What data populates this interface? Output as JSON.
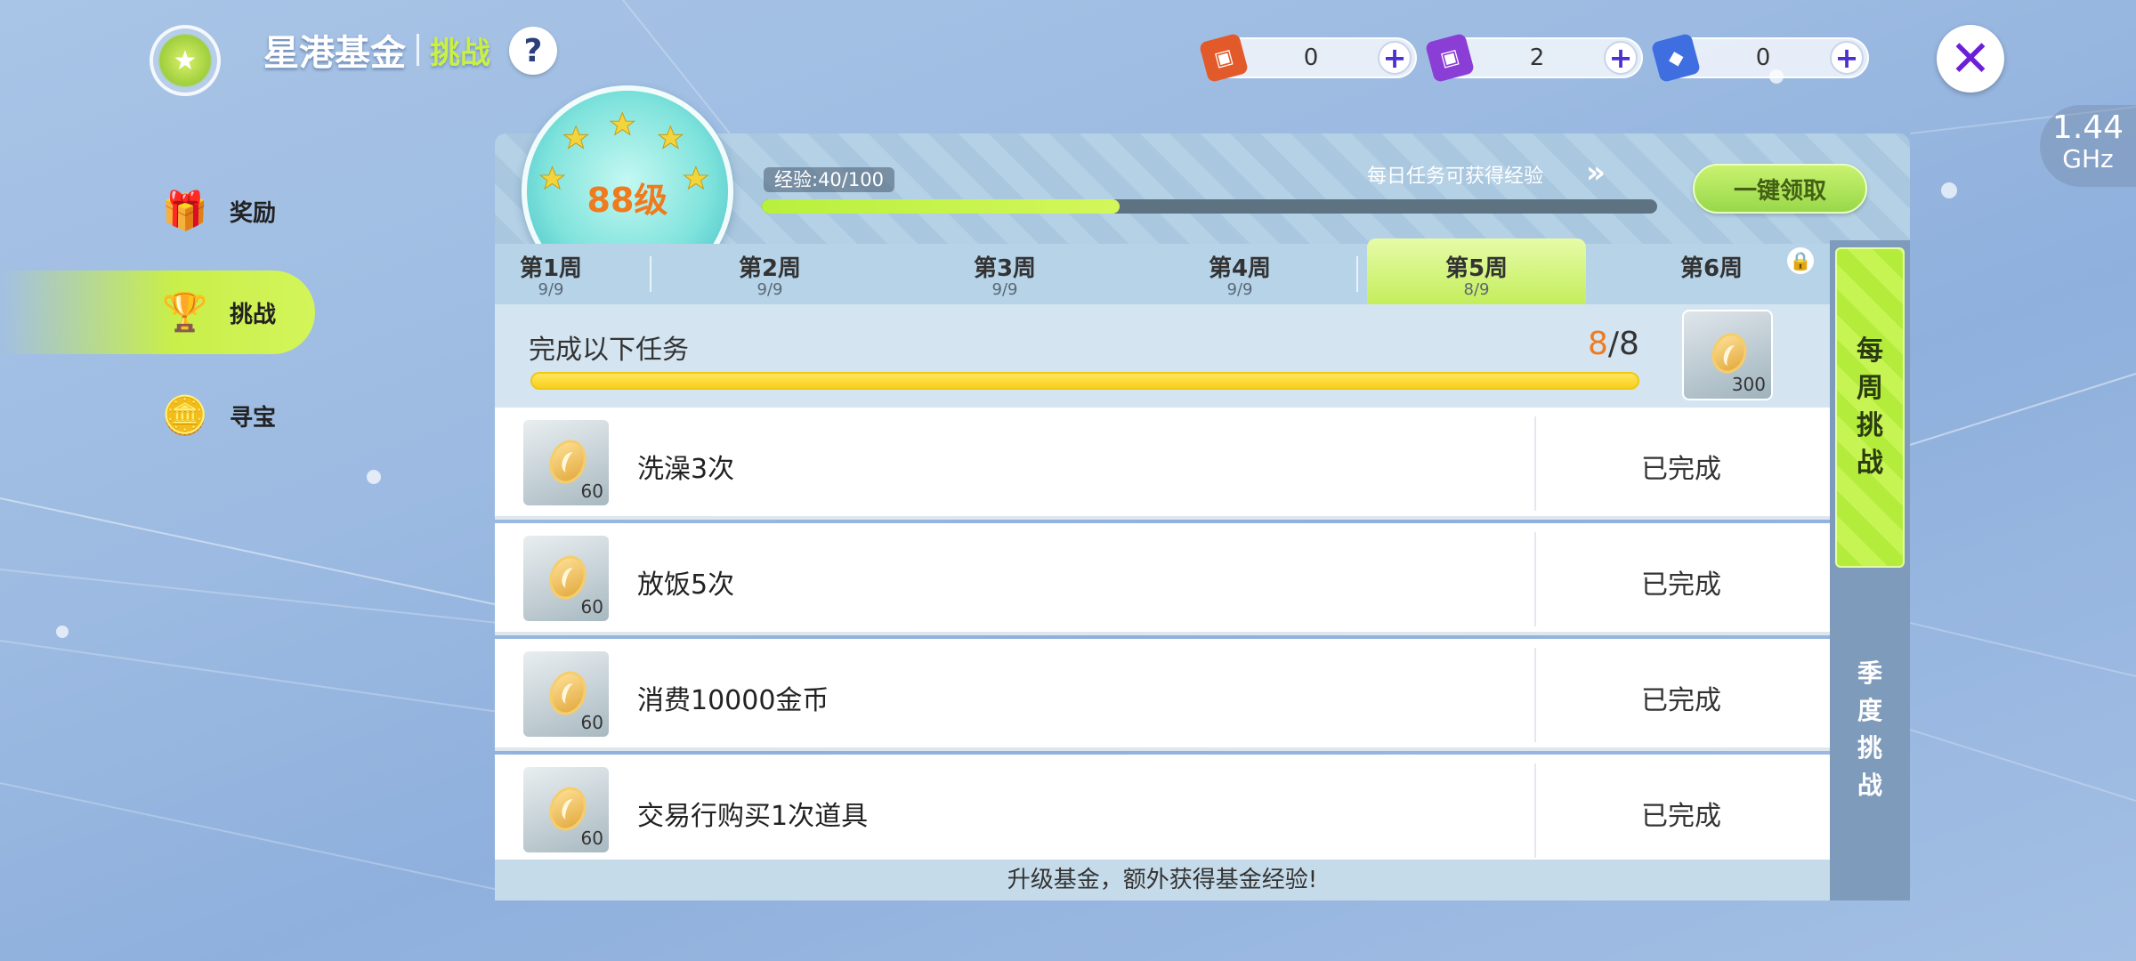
{
  "header": {
    "title": "星港基金",
    "subtitle": "挑战",
    "help_label": "?"
  },
  "currencies": [
    {
      "icon": "red-ticket-icon",
      "value": "0",
      "color": "#e35a2a"
    },
    {
      "icon": "purple-ticket-icon",
      "value": "2",
      "color": "#8b3ed6"
    },
    {
      "icon": "blue-crystal-icon",
      "value": "0",
      "color": "#3e6ee0"
    }
  ],
  "system": {
    "ghz_value": "1.44",
    "ghz_unit": "GHz"
  },
  "nav": {
    "items": [
      {
        "label": "奖励",
        "icon": "gift-icon",
        "active": false
      },
      {
        "label": "挑战",
        "icon": "trophy-icon",
        "active": true
      },
      {
        "label": "寻宝",
        "icon": "coin-stack-icon",
        "active": false
      }
    ]
  },
  "level": {
    "label": "88级",
    "xp_text": "经验:40/100",
    "xp_progress": 0.4,
    "daily_tip": "每日任务可获得经验",
    "claim_all_label": "一键领取"
  },
  "weeks": [
    {
      "name": "第1周",
      "count": "9/9",
      "active": false
    },
    {
      "name": "第2周",
      "count": "9/9",
      "active": false
    },
    {
      "name": "第3周",
      "count": "9/9",
      "active": false
    },
    {
      "name": "第4周",
      "count": "9/9",
      "active": false
    },
    {
      "name": "第5周",
      "count": "8/9",
      "active": true
    },
    {
      "name": "第6周",
      "count": "",
      "active": false,
      "locked": true
    }
  ],
  "task_header": {
    "title": "完成以下任务",
    "done": "8",
    "total": "/8",
    "reward_count": "300"
  },
  "tasks": [
    {
      "name": "洗澡3次",
      "reward": "60",
      "status": "已完成"
    },
    {
      "name": "放饭5次",
      "reward": "60",
      "status": "已完成"
    },
    {
      "name": "消费10000金币",
      "reward": "60",
      "status": "已完成"
    },
    {
      "name": "交易行购买1次道具",
      "reward": "60",
      "status": "已完成"
    }
  ],
  "footer_tip": "升级基金，额外获得基金经验!",
  "side_tabs": {
    "weekly": [
      "每",
      "周",
      "挑",
      "战"
    ],
    "season": [
      "季",
      "度",
      "挑",
      "战"
    ]
  }
}
